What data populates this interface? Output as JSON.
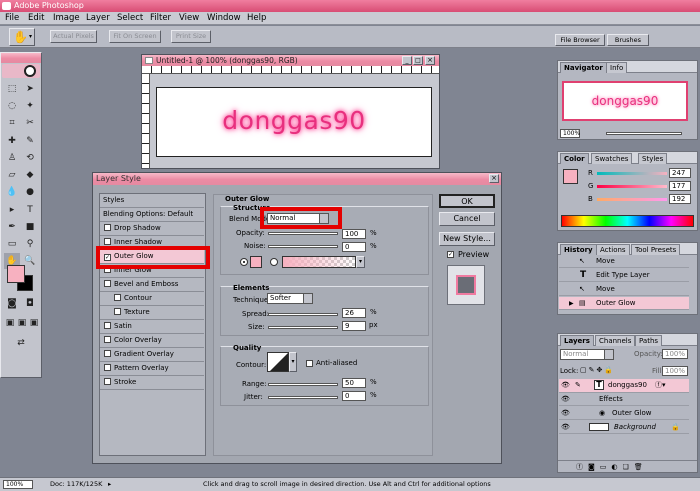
{
  "app": {
    "title": "Adobe Photoshop"
  },
  "menu": [
    "File",
    "Edit",
    "Image",
    "Layer",
    "Select",
    "Filter",
    "View",
    "Window",
    "Help"
  ],
  "options": {
    "actual_pixels": "Actual Pixels",
    "fit_on_screen": "Fit On Screen",
    "print_size": "Print Size",
    "file_browser": "File Browser",
    "brushes": "Brushes"
  },
  "document": {
    "title": "Untitled-1 @ 100% (donggas90, RGB)",
    "text": "donggas90"
  },
  "status": {
    "zoom": "100%",
    "doc": "Doc: 117K/125K",
    "hint": "Click and drag to scroll image in desired direction.  Use Alt and Ctrl for additional options"
  },
  "navigator": {
    "tabs": [
      "Navigator",
      "Info"
    ],
    "preview_text": "donggas90",
    "zoom": "100%"
  },
  "color": {
    "tabs": [
      "Color",
      "Swatches",
      "Styles"
    ],
    "r_label": "R",
    "g_label": "G",
    "b_label": "B",
    "r": "247",
    "g": "177",
    "b": "192",
    "fg": "#f7b1c0"
  },
  "history": {
    "tabs": [
      "History",
      "Actions",
      "Tool Presets"
    ],
    "items": [
      "Move",
      "Edit Type Layer",
      "Move",
      "Outer Glow"
    ]
  },
  "layers": {
    "tabs": [
      "Layers",
      "Channels",
      "Paths"
    ],
    "blend": "Normal",
    "opacity_label": "Opacity:",
    "opacity": "100%",
    "lock_label": "Lock:",
    "fill_label": "Fill:",
    "fill": "100%",
    "layer_name": "donggas90",
    "effects": "Effects",
    "effect_item": "Outer Glow",
    "background": "Background"
  },
  "dialog": {
    "title": "Layer Style",
    "styles_header": "Styles",
    "blending_options": "Blending Options: Default",
    "style_items": [
      "Drop Shadow",
      "Inner Shadow",
      "Outer Glow",
      "Inner Glow",
      "Bevel and Emboss",
      "Contour",
      "Texture",
      "Satin",
      "Color Overlay",
      "Gradient Overlay",
      "Pattern Overlay",
      "Stroke"
    ],
    "ok": "OK",
    "cancel": "Cancel",
    "new_style": "New Style...",
    "preview": "Preview",
    "section_title": "Outer Glow",
    "structure": {
      "title": "Structure",
      "blend_mode_label": "Blend Mode:",
      "blend_mode": "Normal",
      "opacity_label": "Opacity:",
      "opacity": "100",
      "noise_label": "Noise:",
      "noise": "0",
      "unit": "%"
    },
    "elements": {
      "title": "Elements",
      "technique_label": "Technique:",
      "technique": "Softer",
      "spread_label": "Spread:",
      "spread": "26",
      "size_label": "Size:",
      "size": "9",
      "size_unit": "px",
      "spread_unit": "%"
    },
    "quality": {
      "title": "Quality",
      "contour_label": "Contour:",
      "anti_aliased": "Anti-aliased",
      "range_label": "Range:",
      "range": "50",
      "jitter_label": "Jitter:",
      "jitter": "0",
      "unit": "%"
    }
  },
  "accent": "#e8307e"
}
